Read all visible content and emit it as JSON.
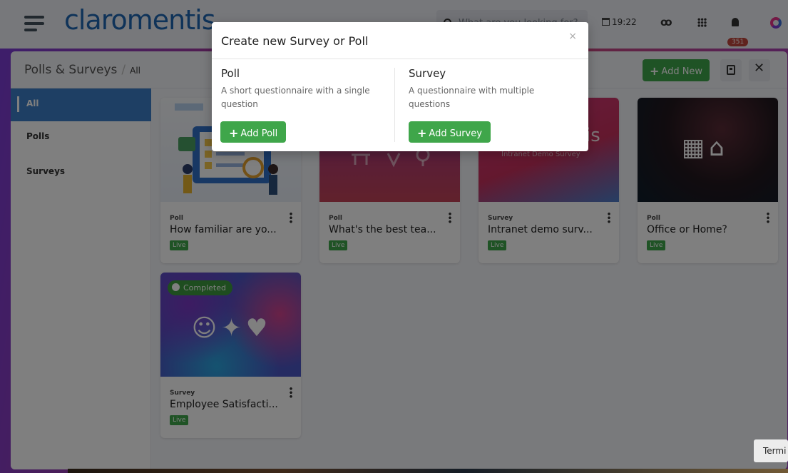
{
  "topbar": {
    "logo": "claromentis",
    "search_placeholder": "What are you looking for?",
    "clock": "19:22",
    "notifications_count": "351"
  },
  "header": {
    "breadcrumb_root": "Polls & Surveys",
    "breadcrumb_separator": "/",
    "breadcrumb_current": "All",
    "add_new_label": "Add New"
  },
  "sidebar": {
    "items": [
      {
        "label": "All",
        "active": true
      },
      {
        "label": "Polls",
        "active": false
      },
      {
        "label": "Surveys",
        "active": false
      }
    ]
  },
  "cards": [
    {
      "type": "Poll",
      "title": "How familiar are yo...",
      "status": "Live"
    },
    {
      "type": "Poll",
      "title": "What's the best tea...",
      "status": "Live"
    },
    {
      "type": "Survey",
      "title": "Intranet demo surv...",
      "status": "Live",
      "image_caption": "Intranet Demo Survey"
    },
    {
      "type": "Poll",
      "title": "Office or Home?",
      "status": "Live"
    },
    {
      "type": "Survey",
      "title": "Employee Satisfacti...",
      "status": "Live",
      "badge": "Completed"
    }
  ],
  "modal": {
    "title": "Create new Survey or Poll",
    "close_symbol": "×",
    "poll": {
      "heading": "Poll",
      "description": "A short questionnaire with a single question",
      "button": "Add Poll"
    },
    "survey": {
      "heading": "Survey",
      "description": "A questionnaire with multiple questions",
      "button": "Add Survey"
    }
  },
  "tooltip": {
    "text": "Termi"
  },
  "colors": {
    "brand_blue": "#1f66b3",
    "accent_green": "#3fa64a",
    "active_blue": "#3d7fc9",
    "badge_red": "#c0463d"
  }
}
